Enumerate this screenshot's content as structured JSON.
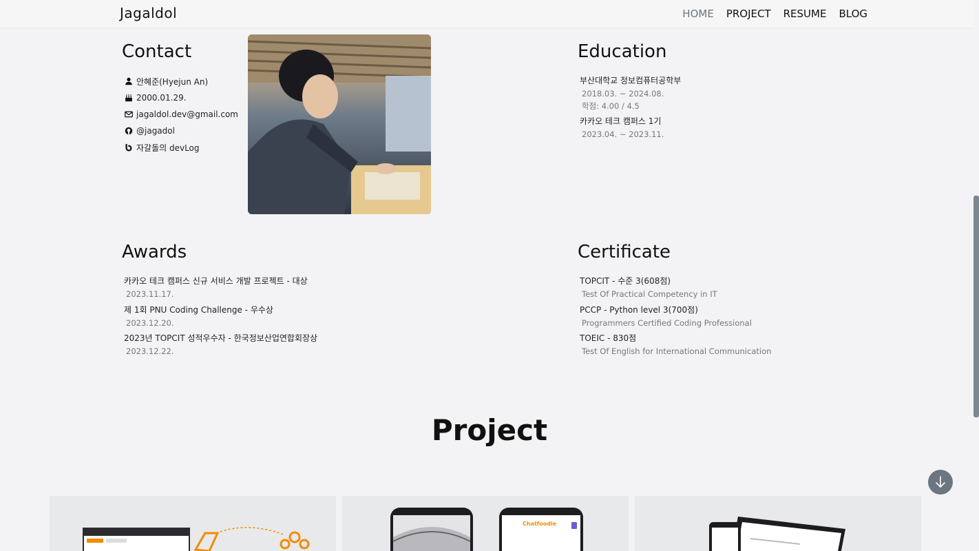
{
  "nav": {
    "brand": "Jagaldol",
    "items": [
      {
        "label": "HOME",
        "active": true
      },
      {
        "label": "PROJECT",
        "active": false
      },
      {
        "label": "RESUME",
        "active": false
      },
      {
        "label": "BLOG",
        "active": false
      }
    ]
  },
  "contact": {
    "title": "Contact",
    "items": [
      {
        "icon": "person-icon",
        "text": "안혜준(Hyejun An)"
      },
      {
        "icon": "cake-icon",
        "text": "2000.01.29."
      },
      {
        "icon": "envelope-icon",
        "text": "jagaldol.dev@gmail.com"
      },
      {
        "icon": "github-icon",
        "text": "@jagadol"
      },
      {
        "icon": "blog-icon",
        "text": "자갈돌의 devLog"
      }
    ]
  },
  "education": {
    "title": "Education",
    "entries": [
      {
        "title": "부산대학교 정보컴퓨터공학부",
        "subs": [
          "2018.03. ~ 2024.08.",
          "학점: 4.00 / 4.5"
        ]
      },
      {
        "title": "카카오 테크 캠퍼스 1기",
        "subs": [
          "2023.04. ~ 2023.11."
        ]
      }
    ]
  },
  "awards": {
    "title": "Awards",
    "entries": [
      {
        "title": "카카오 테크 캠퍼스 신규 서비스 개발 프로젝트 - 대상",
        "subs": [
          "2023.11.17."
        ]
      },
      {
        "title": "제 1회 PNU Coding Challenge - 우수상",
        "subs": [
          "2023.12.20."
        ]
      },
      {
        "title": "2023년 TOPCIT 성적우수자 - 한국정보산업연합회장상",
        "subs": [
          "2023.12.22."
        ]
      }
    ]
  },
  "certificate": {
    "title": "Certificate",
    "entries": [
      {
        "title": "TOPCIT - 수준 3(608점)",
        "subs": [
          "Test Of Practical Competency in IT"
        ]
      },
      {
        "title": "PCCP - Python level 3(700점)",
        "subs": [
          "Programmers Certified Coding Professional"
        ]
      },
      {
        "title": "TOEIC - 830점",
        "subs": [
          "Test Of English for International Communication"
        ]
      }
    ]
  },
  "project": {
    "title": "Project",
    "card1": {
      "logo": "Chatfoodie"
    }
  },
  "colors": {
    "accent": "#6b7680",
    "background": "#f3f3f5",
    "navActive": "#6c757d",
    "chatfoodie": "#f08c00"
  }
}
